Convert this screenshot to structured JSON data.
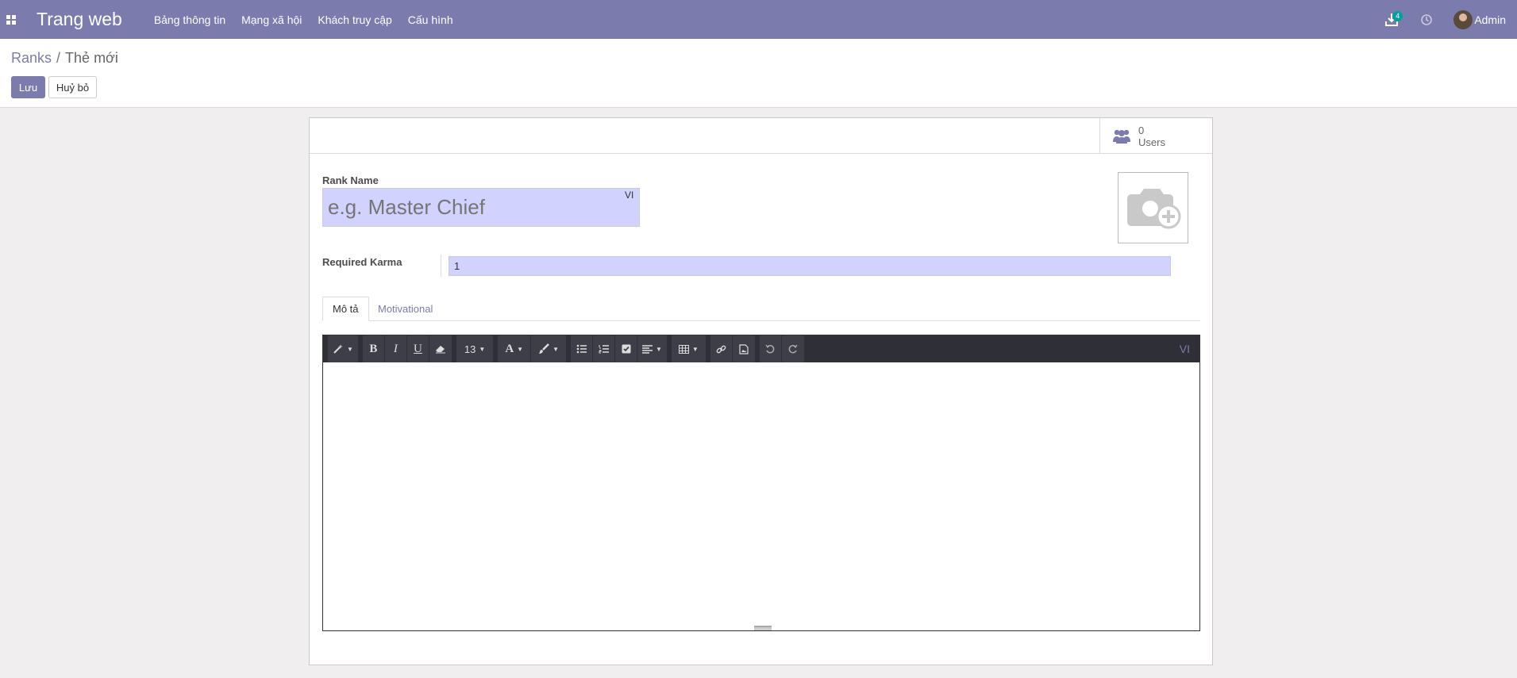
{
  "navbar": {
    "app_title": "Trang web",
    "menu": [
      "Bảng thông tin",
      "Mạng xã hội",
      "Khách truy cập",
      "Cấu hình"
    ],
    "download_badge": "4",
    "user_name": "Admin"
  },
  "breadcrumb": {
    "parent": "Ranks",
    "current": "Thẻ mới"
  },
  "buttons": {
    "save": "Lưu",
    "discard": "Huỷ bỏ"
  },
  "stat_button": {
    "count": "0",
    "label": "Users"
  },
  "form": {
    "rank_name_label": "Rank Name",
    "rank_name_placeholder": "e.g. Master Chief",
    "rank_name_lang": "VI",
    "required_karma_label": "Required Karma",
    "required_karma_value": "1"
  },
  "tabs": [
    "Mô tả",
    "Motivational"
  ],
  "editor": {
    "font_size": "13",
    "lang": "VI"
  },
  "colors": {
    "brand": "#7c7bad",
    "input_bg": "#d2d2ff",
    "badge": "#00a09d",
    "toolbar": "#2f3037"
  }
}
